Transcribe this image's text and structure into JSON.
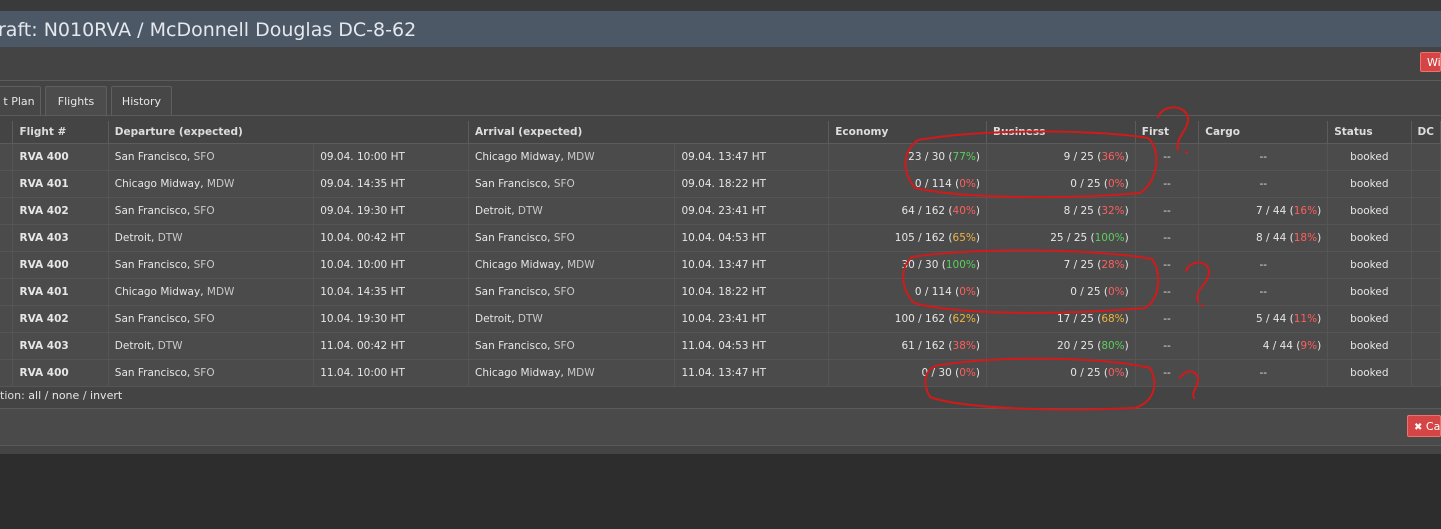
{
  "window": {
    "title": "raft: N010RVA / McDonnell Douglas DC-8-62"
  },
  "toolbar": {
    "right_button_label": "Wi"
  },
  "tabs": [
    {
      "label": "t Plan"
    },
    {
      "label": "Flights"
    },
    {
      "label": "History"
    }
  ],
  "table": {
    "columns": [
      "Flight #",
      "Departure (expected)",
      "Arrival (expected)",
      "Economy",
      "Business",
      "First",
      "Cargo",
      "Status",
      "DC"
    ],
    "rows": [
      {
        "flight": "RVA 400",
        "dep_city": "San Francisco",
        "dep_code": "SFO",
        "dep_time": "09.04. 10:00 HT",
        "arr_city": "Chicago Midway",
        "arr_code": "MDW",
        "arr_time": "09.04. 13:47 HT",
        "economy": "23 / 30",
        "economy_pct": "77%",
        "business": "9 / 25",
        "business_pct": "36%",
        "first": "--",
        "cargo": "--",
        "cargo_pct": "",
        "status": "booked"
      },
      {
        "flight": "RVA 401",
        "dep_city": "Chicago Midway",
        "dep_code": "MDW",
        "dep_time": "09.04. 14:35 HT",
        "arr_city": "San Francisco",
        "arr_code": "SFO",
        "arr_time": "09.04. 18:22 HT",
        "economy": "0 / 114",
        "economy_pct": "0%",
        "business": "0 / 25",
        "business_pct": "0%",
        "first": "--",
        "cargo": "--",
        "cargo_pct": "",
        "status": "booked"
      },
      {
        "flight": "RVA 402",
        "dep_city": "San Francisco",
        "dep_code": "SFO",
        "dep_time": "09.04. 19:30 HT",
        "arr_city": "Detroit",
        "arr_code": "DTW",
        "arr_time": "09.04. 23:41 HT",
        "economy": "64 / 162",
        "economy_pct": "40%",
        "business": "8 / 25",
        "business_pct": "32%",
        "first": "--",
        "cargo": "7 / 44",
        "cargo_pct": "16%",
        "status": "booked"
      },
      {
        "flight": "RVA 403",
        "dep_city": "Detroit",
        "dep_code": "DTW",
        "dep_time": "10.04. 00:42 HT",
        "arr_city": "San Francisco",
        "arr_code": "SFO",
        "arr_time": "10.04. 04:53 HT",
        "economy": "105 / 162",
        "economy_pct": "65%",
        "business": "25 / 25",
        "business_pct": "100%",
        "first": "--",
        "cargo": "8 / 44",
        "cargo_pct": "18%",
        "status": "booked"
      },
      {
        "flight": "RVA 400",
        "dep_city": "San Francisco",
        "dep_code": "SFO",
        "dep_time": "10.04. 10:00 HT",
        "arr_city": "Chicago Midway",
        "arr_code": "MDW",
        "arr_time": "10.04. 13:47 HT",
        "economy": "30 / 30",
        "economy_pct": "100%",
        "business": "7 / 25",
        "business_pct": "28%",
        "first": "--",
        "cargo": "--",
        "cargo_pct": "",
        "status": "booked"
      },
      {
        "flight": "RVA 401",
        "dep_city": "Chicago Midway",
        "dep_code": "MDW",
        "dep_time": "10.04. 14:35 HT",
        "arr_city": "San Francisco",
        "arr_code": "SFO",
        "arr_time": "10.04. 18:22 HT",
        "economy": "0 / 114",
        "economy_pct": "0%",
        "business": "0 / 25",
        "business_pct": "0%",
        "first": "--",
        "cargo": "--",
        "cargo_pct": "",
        "status": "booked"
      },
      {
        "flight": "RVA 402",
        "dep_city": "San Francisco",
        "dep_code": "SFO",
        "dep_time": "10.04. 19:30 HT",
        "arr_city": "Detroit",
        "arr_code": "DTW",
        "arr_time": "10.04. 23:41 HT",
        "economy": "100 / 162",
        "economy_pct": "62%",
        "business": "17 / 25",
        "business_pct": "68%",
        "first": "--",
        "cargo": "5 / 44",
        "cargo_pct": "11%",
        "status": "booked"
      },
      {
        "flight": "RVA 403",
        "dep_city": "Detroit",
        "dep_code": "DTW",
        "dep_time": "11.04. 00:42 HT",
        "arr_city": "San Francisco",
        "arr_code": "SFO",
        "arr_time": "11.04. 04:53 HT",
        "economy": "61 / 162",
        "economy_pct": "38%",
        "business": "20 / 25",
        "business_pct": "80%",
        "first": "--",
        "cargo": "4 / 44",
        "cargo_pct": "9%",
        "status": "booked"
      },
      {
        "flight": "RVA 400",
        "dep_city": "San Francisco",
        "dep_code": "SFO",
        "dep_time": "11.04. 10:00 HT",
        "arr_city": "Chicago Midway",
        "arr_code": "MDW",
        "arr_time": "11.04. 13:47 HT",
        "economy": "0 / 30",
        "economy_pct": "0%",
        "business": "0 / 25",
        "business_pct": "0%",
        "first": "--",
        "cargo": "--",
        "cargo_pct": "",
        "status": "booked"
      }
    ]
  },
  "selection": {
    "label": "tion:",
    "all": "all",
    "none": "none",
    "invert": "invert"
  },
  "footer": {
    "cancel_label": "Ca",
    "cancel_icon": "close-icon"
  },
  "colors": {
    "pct_high": "#5ccf5c",
    "pct_mid": "#f0b43c",
    "pct_low": "#ff5e5e",
    "annotation": "#d21a1a",
    "title_bar": "#4c5866",
    "button": "#d64545"
  }
}
